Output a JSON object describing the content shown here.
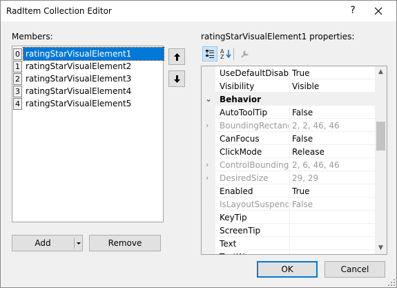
{
  "window": {
    "title": "RadItem Collection Editor",
    "help_glyph": "?",
    "close_glyph": "×"
  },
  "members": {
    "label": "Members:",
    "items": [
      {
        "index": "0",
        "name": "ratingStarVisualElement1",
        "selected": true
      },
      {
        "index": "1",
        "name": "ratingStarVisualElement2"
      },
      {
        "index": "2",
        "name": "ratingStarVisualElement3"
      },
      {
        "index": "3",
        "name": "ratingStarVisualElement4"
      },
      {
        "index": "4",
        "name": "ratingStarVisualElement5"
      }
    ]
  },
  "buttons": {
    "add": "Add",
    "remove": "Remove",
    "ok": "OK",
    "cancel": "Cancel"
  },
  "properties": {
    "label": "ratingStarVisualElement1 properties:",
    "rows": [
      {
        "name": "UseDefaultDisabledPaint",
        "value": "True"
      },
      {
        "name": "Visibility",
        "value": "Visible"
      },
      {
        "name": "Behavior",
        "category": true
      },
      {
        "name": "AutoToolTip",
        "value": "False"
      },
      {
        "name": "BoundingRectangle",
        "value": "2, 2, 46, 46",
        "disabled": true,
        "expandable": true
      },
      {
        "name": "CanFocus",
        "value": "False"
      },
      {
        "name": "ClickMode",
        "value": "Release"
      },
      {
        "name": "ControlBoundingRectangle",
        "value": "2, 6, 46, 46",
        "disabled": true,
        "expandable": true
      },
      {
        "name": "DesiredSize",
        "value": "29, 29",
        "disabled": true,
        "expandable": true
      },
      {
        "name": "Enabled",
        "value": "True"
      },
      {
        "name": "IsLayoutSuspended",
        "value": "False",
        "disabled": true
      },
      {
        "name": "KeyTip",
        "value": ""
      },
      {
        "name": "ScreenTip",
        "value": ""
      },
      {
        "name": "Text",
        "value": ""
      },
      {
        "name": "TextWrap",
        "value": ""
      }
    ]
  },
  "colors": {
    "selection": "#0078d7",
    "disabled_text": "#9a9a9a"
  }
}
